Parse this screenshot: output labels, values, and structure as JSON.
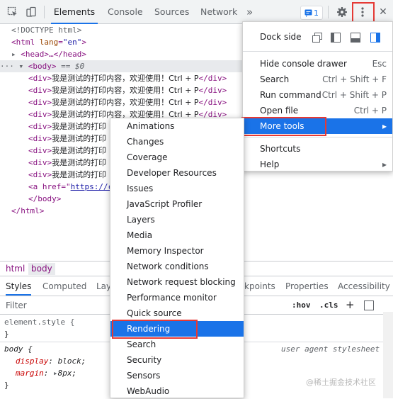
{
  "toolbar": {
    "inspect_icon": "inspect-element-icon",
    "device_icon": "device-toolbar-icon",
    "tabs": [
      "Elements",
      "Console",
      "Sources",
      "Network"
    ],
    "more_tabs_glyph": "»",
    "issues_count": "1",
    "settings_icon": "gear-icon",
    "kebab_icon": "vertical-dots-icon",
    "close_glyph": "✕"
  },
  "dom": {
    "doctype": "<!DOCTYPE html>",
    "html_tag": "html",
    "lang_attr": "lang",
    "lang_val": "\"en\"",
    "head": "<head>…</head>",
    "body_open": "<body>",
    "body_sel": "== $0",
    "div_text": "我是测试的打印内容，欢迎使用！Ctrl + P",
    "div_partial": "我是测试的打印",
    "div_close": "</div>",
    "a_tag": "<a href=\"",
    "a_href": "https://c",
    "body_close": "</body>",
    "html_close": "</html>"
  },
  "breadcrumbs": [
    "html",
    "body"
  ],
  "panel_tabs": {
    "styles": "Styles",
    "computed": "Computed",
    "layout": "Lay",
    "breakpoints": "kpoints",
    "properties": "Properties",
    "accessibility": "Accessibility"
  },
  "filter": {
    "placeholder": "Filter",
    "hov": ":hov",
    "cls": ".cls",
    "plus": "+"
  },
  "styles_pane": {
    "element_style": "element.style {",
    "close1": "}",
    "body_selector": "body {",
    "ua_label": "user agent stylesheet",
    "prop1": "display",
    "val1": "block;",
    "prop2": "margin",
    "val2": "8px;",
    "close2": "}"
  },
  "main_menu": {
    "dock_side": "Dock side",
    "items": [
      {
        "label": "Hide console drawer",
        "shortcut": "Esc"
      },
      {
        "label": "Search",
        "shortcut": "Ctrl + Shift + F"
      },
      {
        "label": "Run command",
        "shortcut": "Ctrl + Shift + P"
      },
      {
        "label": "Open file",
        "shortcut": "Ctrl + P"
      },
      {
        "label": "More tools",
        "shortcut": ""
      },
      {
        "label": "Shortcuts",
        "shortcut": ""
      },
      {
        "label": "Help",
        "shortcut": ""
      }
    ]
  },
  "more_tools_menu": [
    "Animations",
    "Changes",
    "Coverage",
    "Developer Resources",
    "Issues",
    "JavaScript Profiler",
    "Layers",
    "Media",
    "Memory Inspector",
    "Network conditions",
    "Network request blocking",
    "Performance monitor",
    "Quick source",
    "Rendering",
    "Search",
    "Security",
    "Sensors",
    "WebAudio"
  ],
  "watermark": "@稀土掘金技术社区",
  "colors": {
    "accent": "#1a73e8",
    "highlight_box": "#e53935"
  }
}
